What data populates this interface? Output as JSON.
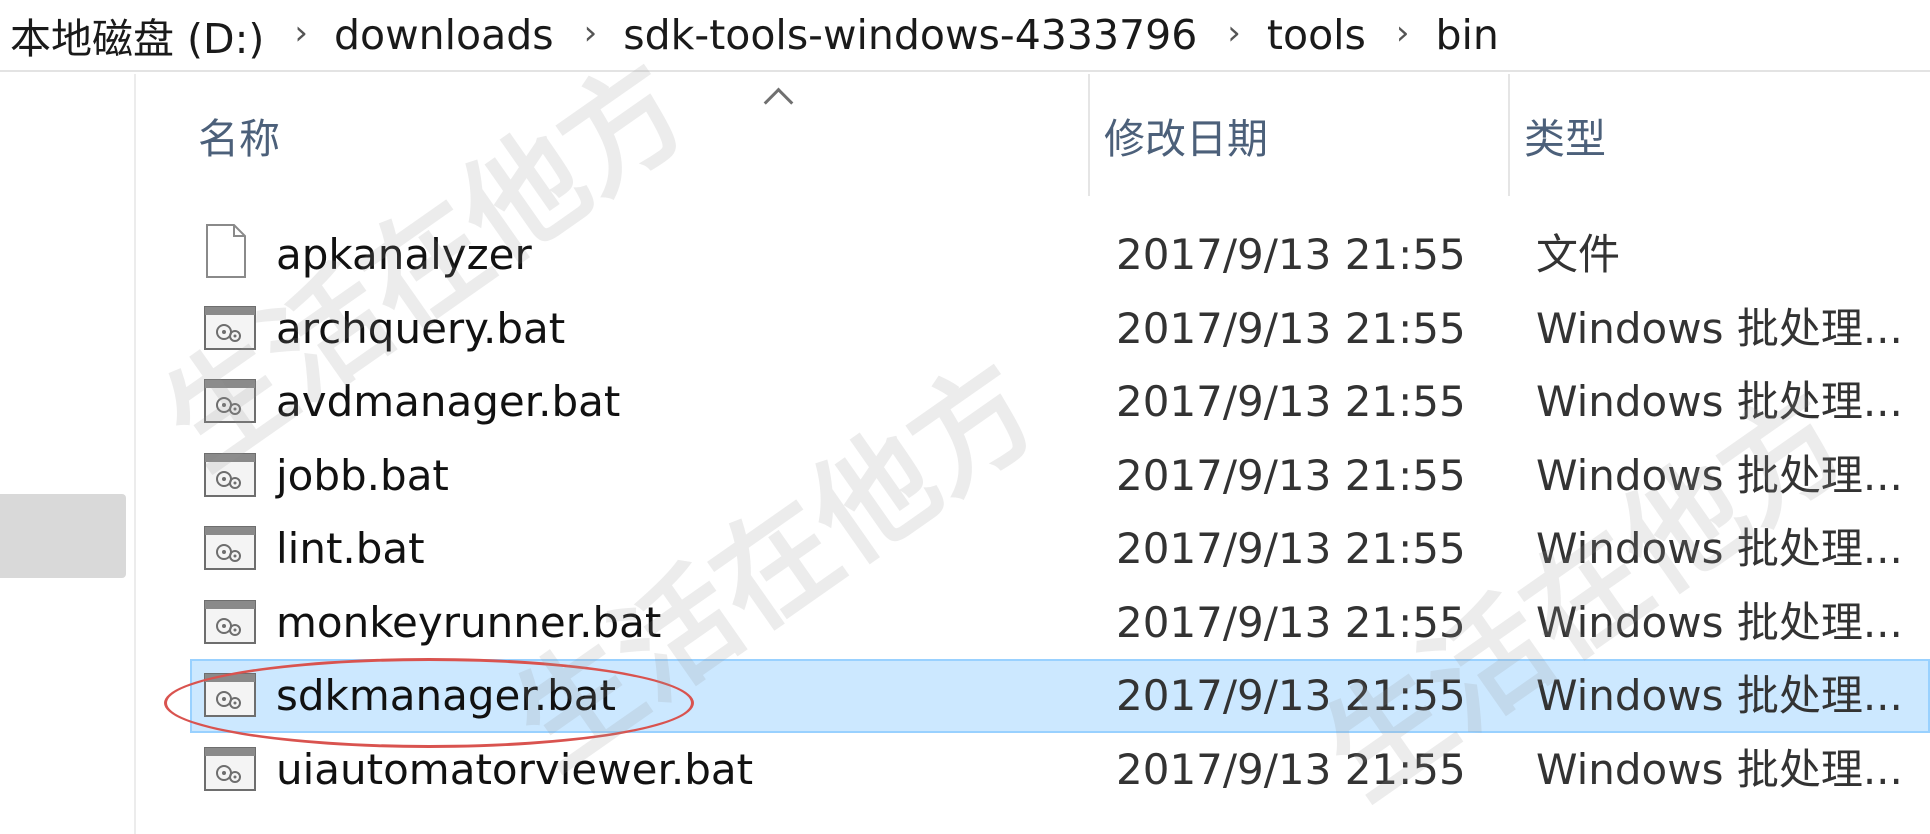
{
  "breadcrumb": {
    "items": [
      "本地磁盘 (D:)",
      "downloads",
      "sdk-tools-windows-4333796",
      "tools",
      "bin"
    ],
    "separator": "›"
  },
  "columns": {
    "name": "名称",
    "date": "修改日期",
    "type": "类型"
  },
  "files": [
    {
      "name": "apkanalyzer",
      "date": "2017/9/13 21:55",
      "type": "文件",
      "icon": "blank-file-icon",
      "selected": false
    },
    {
      "name": "archquery.bat",
      "date": "2017/9/13 21:55",
      "type": "Windows 批处理...",
      "icon": "batch-file-icon",
      "selected": false
    },
    {
      "name": "avdmanager.bat",
      "date": "2017/9/13 21:55",
      "type": "Windows 批处理...",
      "icon": "batch-file-icon",
      "selected": false
    },
    {
      "name": "jobb.bat",
      "date": "2017/9/13 21:55",
      "type": "Windows 批处理...",
      "icon": "batch-file-icon",
      "selected": false
    },
    {
      "name": "lint.bat",
      "date": "2017/9/13 21:55",
      "type": "Windows 批处理...",
      "icon": "batch-file-icon",
      "selected": false
    },
    {
      "name": "monkeyrunner.bat",
      "date": "2017/9/13 21:55",
      "type": "Windows 批处理...",
      "icon": "batch-file-icon",
      "selected": false
    },
    {
      "name": "sdkmanager.bat",
      "date": "2017/9/13 21:55",
      "type": "Windows 批处理...",
      "icon": "batch-file-icon",
      "selected": true
    },
    {
      "name": "uiautomatorviewer.bat",
      "date": "2017/9/13 21:55",
      "type": "Windows 批处理...",
      "icon": "batch-file-icon",
      "selected": false
    }
  ],
  "watermark": "生活在他方",
  "colors": {
    "selection_bg": "#cce8ff",
    "selection_border": "#99d1ff",
    "annotation": "#d9534f",
    "header_text": "#4c607a"
  }
}
